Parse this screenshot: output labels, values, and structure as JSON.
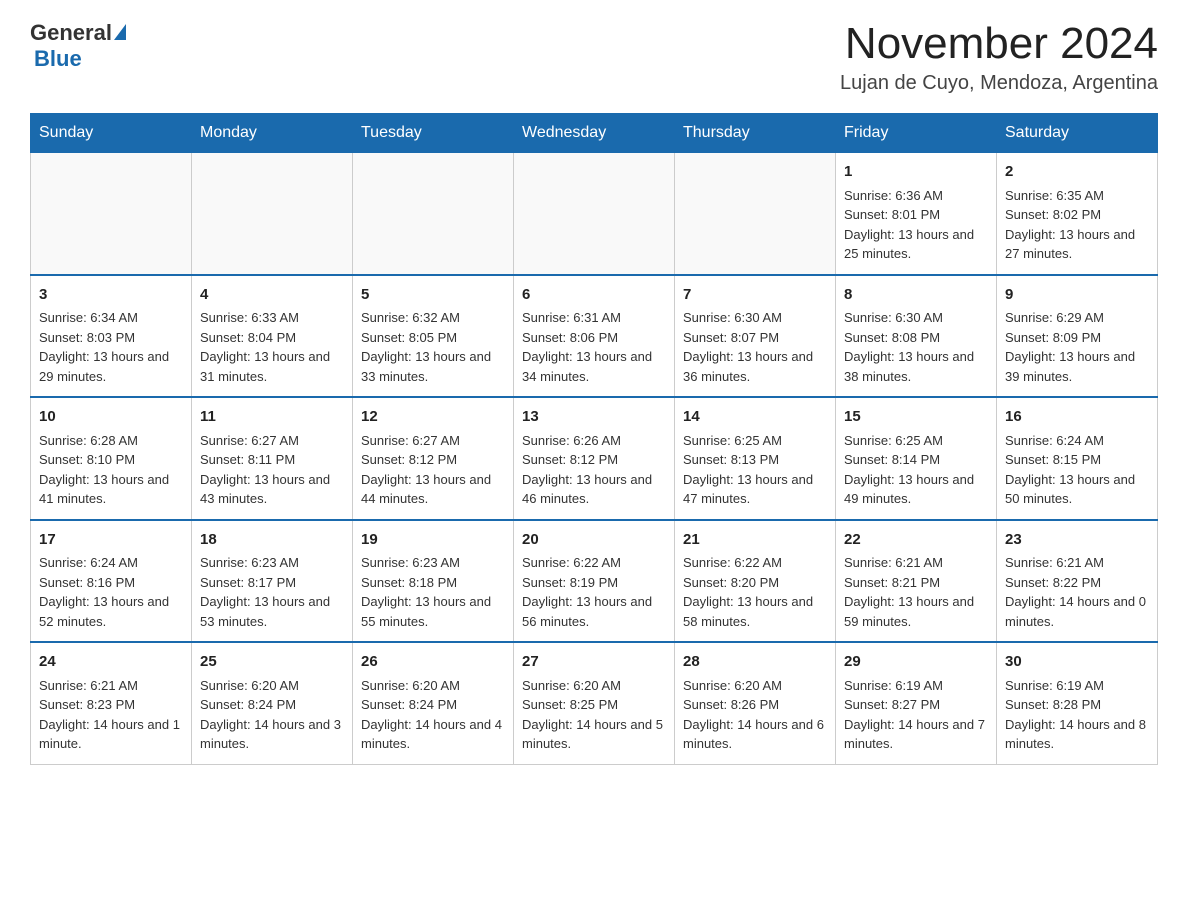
{
  "header": {
    "logo_general": "General",
    "logo_blue": "Blue",
    "month_title": "November 2024",
    "location": "Lujan de Cuyo, Mendoza, Argentina"
  },
  "days_of_week": [
    "Sunday",
    "Monday",
    "Tuesday",
    "Wednesday",
    "Thursday",
    "Friday",
    "Saturday"
  ],
  "weeks": [
    [
      {
        "day": "",
        "info": ""
      },
      {
        "day": "",
        "info": ""
      },
      {
        "day": "",
        "info": ""
      },
      {
        "day": "",
        "info": ""
      },
      {
        "day": "",
        "info": ""
      },
      {
        "day": "1",
        "info": "Sunrise: 6:36 AM\nSunset: 8:01 PM\nDaylight: 13 hours and 25 minutes."
      },
      {
        "day": "2",
        "info": "Sunrise: 6:35 AM\nSunset: 8:02 PM\nDaylight: 13 hours and 27 minutes."
      }
    ],
    [
      {
        "day": "3",
        "info": "Sunrise: 6:34 AM\nSunset: 8:03 PM\nDaylight: 13 hours and 29 minutes."
      },
      {
        "day": "4",
        "info": "Sunrise: 6:33 AM\nSunset: 8:04 PM\nDaylight: 13 hours and 31 minutes."
      },
      {
        "day": "5",
        "info": "Sunrise: 6:32 AM\nSunset: 8:05 PM\nDaylight: 13 hours and 33 minutes."
      },
      {
        "day": "6",
        "info": "Sunrise: 6:31 AM\nSunset: 8:06 PM\nDaylight: 13 hours and 34 minutes."
      },
      {
        "day": "7",
        "info": "Sunrise: 6:30 AM\nSunset: 8:07 PM\nDaylight: 13 hours and 36 minutes."
      },
      {
        "day": "8",
        "info": "Sunrise: 6:30 AM\nSunset: 8:08 PM\nDaylight: 13 hours and 38 minutes."
      },
      {
        "day": "9",
        "info": "Sunrise: 6:29 AM\nSunset: 8:09 PM\nDaylight: 13 hours and 39 minutes."
      }
    ],
    [
      {
        "day": "10",
        "info": "Sunrise: 6:28 AM\nSunset: 8:10 PM\nDaylight: 13 hours and 41 minutes."
      },
      {
        "day": "11",
        "info": "Sunrise: 6:27 AM\nSunset: 8:11 PM\nDaylight: 13 hours and 43 minutes."
      },
      {
        "day": "12",
        "info": "Sunrise: 6:27 AM\nSunset: 8:12 PM\nDaylight: 13 hours and 44 minutes."
      },
      {
        "day": "13",
        "info": "Sunrise: 6:26 AM\nSunset: 8:12 PM\nDaylight: 13 hours and 46 minutes."
      },
      {
        "day": "14",
        "info": "Sunrise: 6:25 AM\nSunset: 8:13 PM\nDaylight: 13 hours and 47 minutes."
      },
      {
        "day": "15",
        "info": "Sunrise: 6:25 AM\nSunset: 8:14 PM\nDaylight: 13 hours and 49 minutes."
      },
      {
        "day": "16",
        "info": "Sunrise: 6:24 AM\nSunset: 8:15 PM\nDaylight: 13 hours and 50 minutes."
      }
    ],
    [
      {
        "day": "17",
        "info": "Sunrise: 6:24 AM\nSunset: 8:16 PM\nDaylight: 13 hours and 52 minutes."
      },
      {
        "day": "18",
        "info": "Sunrise: 6:23 AM\nSunset: 8:17 PM\nDaylight: 13 hours and 53 minutes."
      },
      {
        "day": "19",
        "info": "Sunrise: 6:23 AM\nSunset: 8:18 PM\nDaylight: 13 hours and 55 minutes."
      },
      {
        "day": "20",
        "info": "Sunrise: 6:22 AM\nSunset: 8:19 PM\nDaylight: 13 hours and 56 minutes."
      },
      {
        "day": "21",
        "info": "Sunrise: 6:22 AM\nSunset: 8:20 PM\nDaylight: 13 hours and 58 minutes."
      },
      {
        "day": "22",
        "info": "Sunrise: 6:21 AM\nSunset: 8:21 PM\nDaylight: 13 hours and 59 minutes."
      },
      {
        "day": "23",
        "info": "Sunrise: 6:21 AM\nSunset: 8:22 PM\nDaylight: 14 hours and 0 minutes."
      }
    ],
    [
      {
        "day": "24",
        "info": "Sunrise: 6:21 AM\nSunset: 8:23 PM\nDaylight: 14 hours and 1 minute."
      },
      {
        "day": "25",
        "info": "Sunrise: 6:20 AM\nSunset: 8:24 PM\nDaylight: 14 hours and 3 minutes."
      },
      {
        "day": "26",
        "info": "Sunrise: 6:20 AM\nSunset: 8:24 PM\nDaylight: 14 hours and 4 minutes."
      },
      {
        "day": "27",
        "info": "Sunrise: 6:20 AM\nSunset: 8:25 PM\nDaylight: 14 hours and 5 minutes."
      },
      {
        "day": "28",
        "info": "Sunrise: 6:20 AM\nSunset: 8:26 PM\nDaylight: 14 hours and 6 minutes."
      },
      {
        "day": "29",
        "info": "Sunrise: 6:19 AM\nSunset: 8:27 PM\nDaylight: 14 hours and 7 minutes."
      },
      {
        "day": "30",
        "info": "Sunrise: 6:19 AM\nSunset: 8:28 PM\nDaylight: 14 hours and 8 minutes."
      }
    ]
  ]
}
